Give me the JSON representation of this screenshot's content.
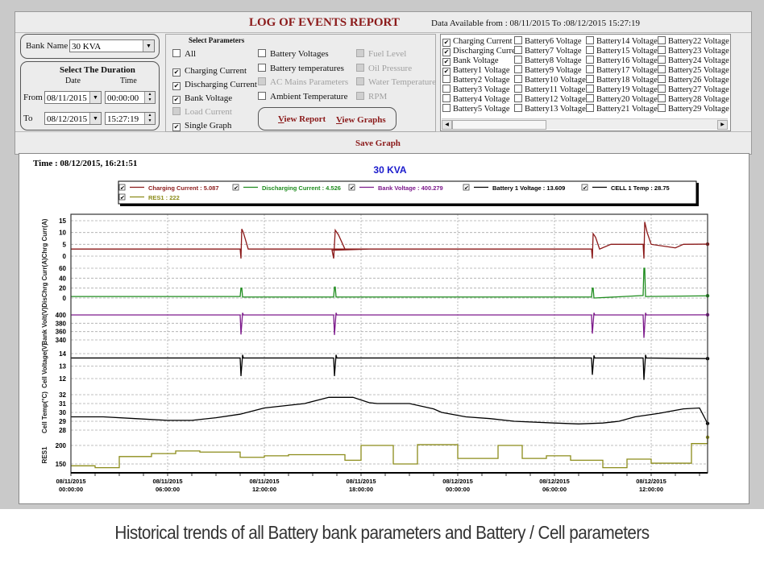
{
  "header": {
    "title": "LOG OF EVENTS REPORT",
    "data_available": "Data Available from : 08/11/2015 To :08/12/2015 15:27:19"
  },
  "bank": {
    "label": "Bank Name",
    "value": "30 KVA"
  },
  "duration": {
    "title": "Select The Duration",
    "date_header": "Date",
    "time_header": "Time",
    "from_label": "From",
    "from_date": "08/11/2015",
    "from_time": "00:00:00",
    "to_label": "To",
    "to_date": "08/12/2015",
    "to_time": "15:27:19"
  },
  "parameters": {
    "title": "Select Parameters",
    "col1": [
      {
        "label": "All",
        "checked": false,
        "disabled": false
      },
      {
        "label": "Charging Current",
        "checked": true,
        "disabled": false
      },
      {
        "label": "Discharging Current",
        "checked": true,
        "disabled": false
      },
      {
        "label": "Bank Voltage",
        "checked": true,
        "disabled": false
      },
      {
        "label": "Load Current",
        "checked": false,
        "disabled": true
      },
      {
        "label": "Single Graph",
        "checked": true,
        "disabled": false
      }
    ],
    "col2": [
      {
        "label": "Battery Voltages",
        "checked": false,
        "disabled": false
      },
      {
        "label": "Battery temperatures",
        "checked": false,
        "disabled": false
      },
      {
        "label": "AC Mains Parameters",
        "checked": false,
        "disabled": true
      },
      {
        "label": "Ambient Temperature",
        "checked": false,
        "disabled": false
      }
    ],
    "col3": [
      {
        "label": "Fuel Level",
        "checked": false,
        "disabled": true
      },
      {
        "label": "Oil Pressure",
        "checked": false,
        "disabled": true
      },
      {
        "label": "Water Temperature",
        "checked": false,
        "disabled": true
      },
      {
        "label": "RPM",
        "checked": false,
        "disabled": true
      }
    ]
  },
  "actions": {
    "view_report_u": "V",
    "view_report_rest": "iew Report",
    "view_graphs_u": "V",
    "view_graphs_rest": "iew Graphs",
    "save_graph": "Save Graph"
  },
  "series_list": {
    "columns": [
      [
        {
          "label": "Charging Current",
          "checked": true
        },
        {
          "label": "Discharging Curre:",
          "checked": true
        },
        {
          "label": "Bank Voltage",
          "checked": true
        },
        {
          "label": "Battery1 Voltage",
          "checked": true
        },
        {
          "label": "Battery2 Voltage",
          "checked": false
        },
        {
          "label": "Battery3 Voltage",
          "checked": false
        },
        {
          "label": "Battery4 Voltage",
          "checked": false
        },
        {
          "label": "Battery5 Voltage",
          "checked": false
        }
      ],
      [
        {
          "label": "Battery6 Voltage",
          "checked": false
        },
        {
          "label": "Battery7 Voltage",
          "checked": false
        },
        {
          "label": "Battery8 Voltage",
          "checked": false
        },
        {
          "label": "Battery9 Voltage",
          "checked": false
        },
        {
          "label": "Battery10 Voltage",
          "checked": false
        },
        {
          "label": "Battery11 Voltage",
          "checked": false
        },
        {
          "label": "Battery12 Voltage",
          "checked": false
        },
        {
          "label": "Battery13 Voltage",
          "checked": false
        }
      ],
      [
        {
          "label": "Battery14 Voltage",
          "checked": false
        },
        {
          "label": "Battery15 Voltage",
          "checked": false
        },
        {
          "label": "Battery16 Voltage",
          "checked": false
        },
        {
          "label": "Battery17 Voltage",
          "checked": false
        },
        {
          "label": "Battery18 Voltage",
          "checked": false
        },
        {
          "label": "Battery19 Voltage",
          "checked": false
        },
        {
          "label": "Battery20 Voltage",
          "checked": false
        },
        {
          "label": "Battery21 Voltage",
          "checked": false
        }
      ],
      [
        {
          "label": "Battery22 Voltage",
          "checked": false
        },
        {
          "label": "Battery23 Voltage",
          "checked": false
        },
        {
          "label": "Battery24 Voltage",
          "checked": false
        },
        {
          "label": "Battery25 Voltage",
          "checked": false
        },
        {
          "label": "Battery26 Voltage",
          "checked": false
        },
        {
          "label": "Battery27 Voltage",
          "checked": false
        },
        {
          "label": "Battery28 Voltage",
          "checked": false
        },
        {
          "label": "Battery29 Voltage",
          "checked": false
        }
      ]
    ]
  },
  "graph": {
    "time_label": "Time : 08/12/2015, 16:21:51",
    "bank_title": "30 KVA",
    "title_color": "#1a1acc"
  },
  "caption": "Historical trends of all Battery bank parameters and Battery / Cell parameters",
  "chart_data": {
    "type": "line",
    "title": "30 KVA",
    "x_unit": "hours since 08/11/2015 00:00:00",
    "xlim": [
      0,
      39.5
    ],
    "x_ticks": [
      {
        "hours": 0,
        "label": [
          "08/11/2015",
          "00:00:00"
        ]
      },
      {
        "hours": 6,
        "label": [
          "08/11/2015",
          "06:00:00"
        ]
      },
      {
        "hours": 12,
        "label": [
          "08/11/2015",
          "12:00:00"
        ]
      },
      {
        "hours": 18,
        "label": [
          "08/11/2015",
          "18:00:00"
        ]
      },
      {
        "hours": 24,
        "label": [
          "08/12/2015",
          "00:00:00"
        ]
      },
      {
        "hours": 30,
        "label": [
          "08/12/2015",
          "06:00:00"
        ]
      },
      {
        "hours": 36,
        "label": [
          "08/12/2015",
          "12:00:00"
        ]
      }
    ],
    "grid": true,
    "legend_position": "top-center",
    "legend": [
      {
        "text": "Charging Current : 5.087",
        "color": "#8b1a1a",
        "checked": true
      },
      {
        "text": "Discharging Current : 4.526",
        "color": "#1e8c1e",
        "checked": true
      },
      {
        "text": "Bank Voltage : 400.279",
        "color": "#7d1a8c",
        "checked": true
      },
      {
        "text": "Battery 1 Voltage : 13.609",
        "color": "#000000",
        "checked": true
      },
      {
        "text": "CELL 1 Temp : 28.75",
        "color": "#000000",
        "checked": true
      },
      {
        "text": "RES1 : 222",
        "color": "#8c8c1a",
        "checked": true
      }
    ],
    "panels": [
      {
        "name": "Charging Current",
        "ylabel": "Chrg Curr(A)",
        "ylim": [
          0,
          15
        ],
        "yticks": [
          0,
          5,
          10,
          15
        ],
        "color": "#8b1a1a",
        "x": [
          0,
          4.5,
          10.5,
          10.55,
          10.6,
          10.7,
          11,
          15,
          17.5,
          18.5,
          16.2,
          16.3,
          16.4,
          16.6,
          17,
          20,
          30,
          32.3,
          32.35,
          32.4,
          32.55,
          32.8,
          33.5,
          35.5,
          35.55,
          35.6,
          35.75,
          36,
          37,
          37.5,
          38,
          39.5
        ],
        "y": [
          3,
          3,
          3,
          -1,
          11.5,
          10,
          3,
          3,
          3,
          3,
          2.5,
          -1,
          11,
          9,
          3,
          3,
          3,
          3,
          -1,
          9.5,
          8,
          3,
          5,
          5,
          -1,
          14.5,
          10,
          5,
          4,
          3.5,
          5,
          5.1
        ]
      },
      {
        "name": "Discharging Current",
        "ylabel": "DisChrg Curr(A)",
        "ylim": [
          0,
          60
        ],
        "yticks": [
          0,
          20,
          40,
          60
        ],
        "color": "#1e8c1e",
        "x": [
          0,
          10.5,
          10.55,
          10.6,
          10.65,
          16.3,
          16.35,
          16.4,
          16.45,
          32.3,
          32.35,
          32.4,
          32.45,
          35.5,
          35.55,
          35.6,
          35.65,
          39.5
        ],
        "y": [
          3,
          3,
          20,
          20,
          2,
          2,
          22,
          22,
          2,
          2,
          20,
          20,
          0,
          5,
          60,
          60,
          3,
          4.5
        ]
      },
      {
        "name": "Bank Voltage",
        "ylabel": "Bank Volt(V)",
        "ylim": [
          340,
          400
        ],
        "yticks": [
          340,
          360,
          380,
          400
        ],
        "color": "#7d1a8c",
        "x": [
          0,
          10.5,
          10.55,
          10.65,
          10.7,
          16.3,
          16.35,
          16.45,
          16.5,
          32.3,
          32.35,
          32.45,
          32.5,
          35.5,
          35.55,
          35.65,
          35.7,
          39.5
        ],
        "y": [
          400,
          400,
          353,
          405,
          400,
          400,
          352,
          405,
          400,
          400,
          355,
          405,
          400,
          400,
          345,
          405,
          400,
          400.3
        ]
      },
      {
        "name": "Battery 1 Voltage",
        "ylabel": "Cell Voltage(V)",
        "ylim": [
          12,
          14
        ],
        "yticks": [
          12,
          13,
          14
        ],
        "color": "#000000",
        "x": [
          0,
          10.5,
          10.55,
          10.65,
          10.7,
          16.3,
          16.35,
          16.45,
          16.5,
          32.3,
          32.35,
          32.45,
          32.5,
          35.5,
          35.55,
          35.65,
          35.7,
          39.5
        ],
        "y": [
          13.65,
          13.65,
          12.2,
          13.9,
          13.65,
          13.65,
          12.2,
          13.9,
          13.65,
          13.65,
          12.3,
          13.85,
          13.65,
          13.65,
          11.9,
          13.9,
          13.65,
          13.6
        ]
      },
      {
        "name": "CELL 1 Temp",
        "ylabel": "Cell Temp(°C)",
        "ylim": [
          28,
          32
        ],
        "yticks": [
          28,
          29,
          30,
          31,
          32
        ],
        "color": "#000000",
        "x": [
          0,
          2,
          4,
          6,
          7.5,
          9,
          10.5,
          12,
          14.5,
          16,
          17.5,
          18.5,
          19,
          21,
          22.5,
          23,
          24.5,
          26,
          27.5,
          30,
          31.5,
          33,
          34,
          35,
          36.5,
          38,
          39,
          39.5
        ],
        "y": [
          29.5,
          29.5,
          29.3,
          29.1,
          29.1,
          29.4,
          29.8,
          30.5,
          31,
          31.7,
          31.7,
          31.1,
          31,
          31,
          30.4,
          30,
          29.5,
          29.3,
          29,
          28.8,
          28.7,
          28.8,
          29.0,
          29.5,
          29.9,
          30.4,
          30.5,
          28.75
        ]
      },
      {
        "name": "RES1",
        "ylabel": "RES1",
        "ylim": [
          135,
          215
        ],
        "yticks": [
          150,
          200
        ],
        "color": "#8c8c1a",
        "step": true,
        "x": [
          0,
          1.5,
          3,
          5,
          6.5,
          8,
          10.5,
          12,
          13.5,
          15,
          17,
          18,
          20,
          21.5,
          24,
          26.5,
          28,
          29.5,
          31,
          33,
          34.5,
          36,
          38.5,
          39.5
        ],
        "y": [
          145,
          140,
          170,
          178,
          185,
          182,
          168,
          172,
          175,
          175,
          160,
          200,
          150,
          202,
          165,
          200,
          165,
          172,
          160,
          140,
          163,
          152,
          205,
          222
        ]
      }
    ]
  }
}
